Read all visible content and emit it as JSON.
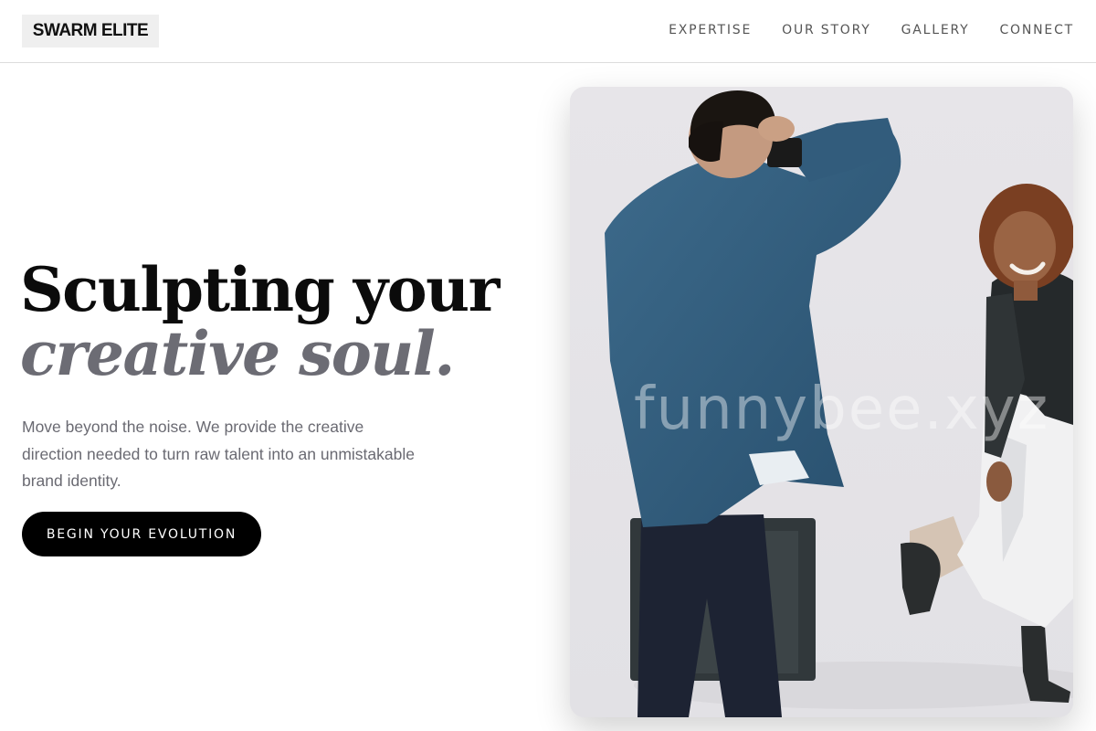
{
  "header": {
    "logo": "SWARM ELITE",
    "nav": [
      {
        "label": "EXPERTISE"
      },
      {
        "label": "OUR STORY"
      },
      {
        "label": "GALLERY"
      },
      {
        "label": "CONNECT"
      }
    ]
  },
  "hero": {
    "headline_line1": "Sculpting your",
    "headline_line2": "creative soul.",
    "description": "Move beyond the noise. We provide the creative direction needed to turn raw talent into an unmistakable brand identity.",
    "cta_label": "BEGIN YOUR EVOLUTION",
    "image": {
      "watermark": "funnybee.xyz"
    }
  },
  "colors": {
    "accent_text": "#6c6c74",
    "button_bg": "#000000",
    "logo_bg": "#efefef"
  }
}
